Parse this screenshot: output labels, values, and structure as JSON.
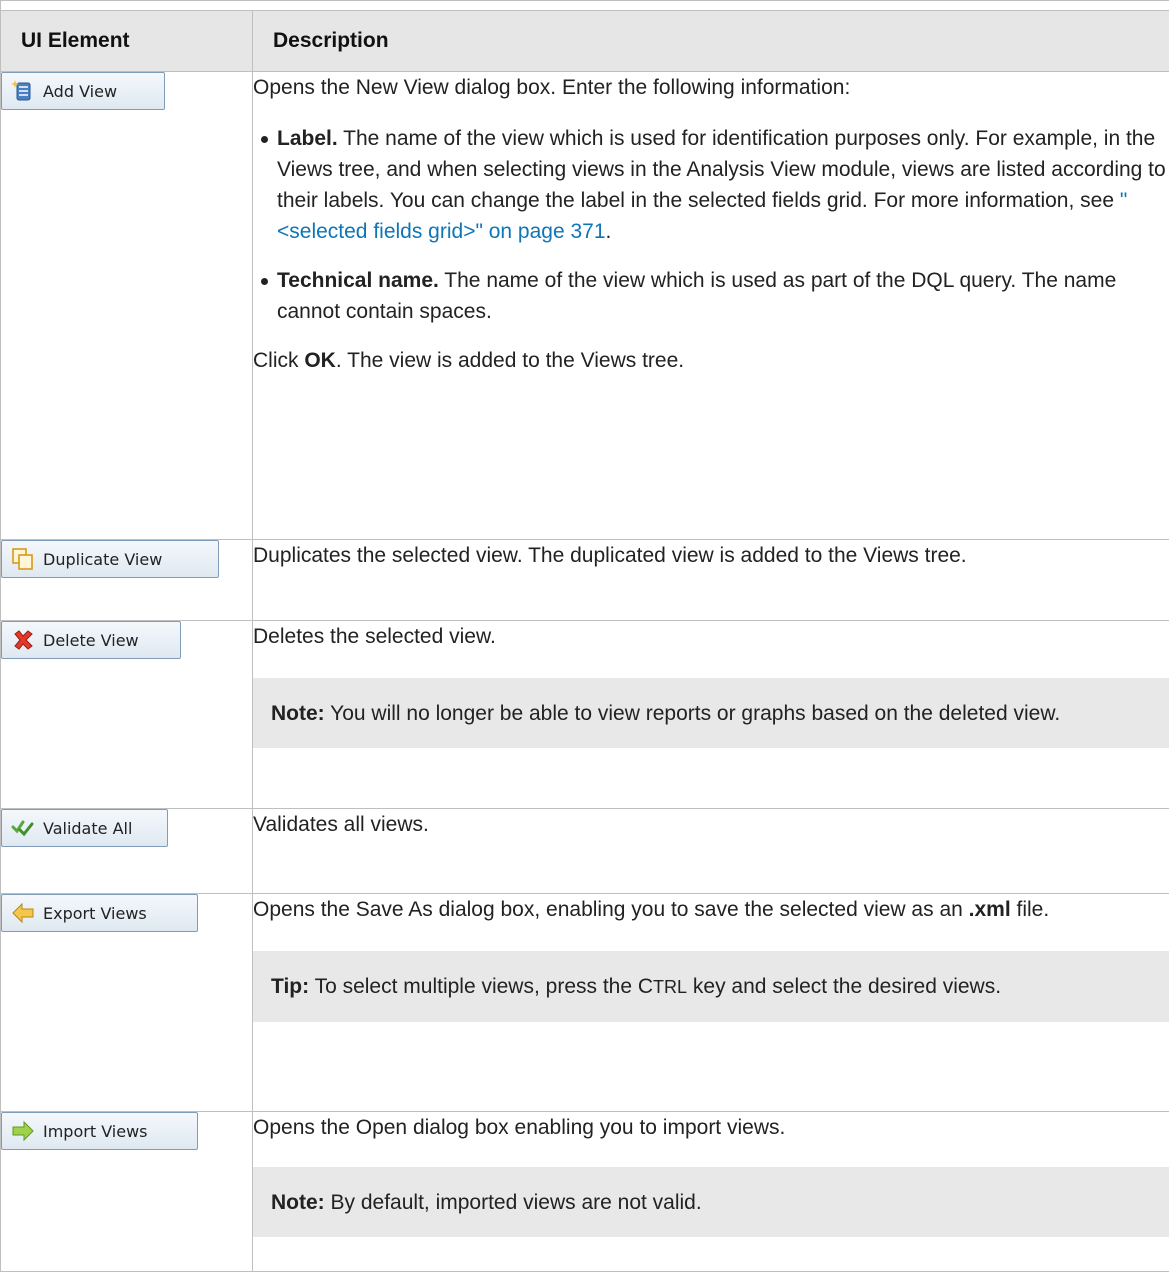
{
  "headers": {
    "ui_element": "UI Element",
    "description": "Description"
  },
  "rows": [
    {
      "button": {
        "label": "Add View",
        "icon": "add-view-icon"
      },
      "intro": "Opens the New View dialog box. Enter the following information:",
      "bullets": [
        {
          "term": "Label.",
          "text": " The name of the view which is used for identification purposes only. For example, in the Views tree, and when selecting views in the Analysis View module, views are listed according to their labels. You can change the label in the selected fields grid. For more information, see ",
          "link": "\"<selected fields grid>\" on page 371",
          "after": "."
        },
        {
          "term": "Technical name.",
          "text": " The name of the view which is used as part of the DQL query. The name cannot contain spaces."
        }
      ],
      "outro_pre": "Click ",
      "outro_bold": "OK",
      "outro_post": ". The view is added to the Views tree."
    },
    {
      "button": {
        "label": "Duplicate View",
        "icon": "duplicate-icon"
      },
      "text": "Duplicates the selected view. The duplicated view is added to the Views tree."
    },
    {
      "button": {
        "label": "Delete View",
        "icon": "delete-x-icon"
      },
      "text": "Deletes the selected view.",
      "note_label": "Note:",
      "note_text": " You will no longer be able to view reports or graphs based on the deleted view."
    },
    {
      "button": {
        "label": "Validate All",
        "icon": "validate-checkmarks-icon"
      },
      "text": "Validates all views."
    },
    {
      "button": {
        "label": "Export Views",
        "icon": "export-arrow-icon"
      },
      "text_pre": "Opens the Save As dialog box, enabling you to save the selected view as an ",
      "text_bold": ".xml",
      "text_post": " file.",
      "tip_label": "Tip:",
      "tip_pre": " To select multiple views, press the ",
      "tip_key_c": "C",
      "tip_key_rest": "TRL",
      "tip_post": " key and select the desired views."
    },
    {
      "button": {
        "label": "Import Views",
        "icon": "import-arrow-icon"
      },
      "text": "Opens the Open dialog box enabling you to import views.",
      "note_label": "Note:",
      "note_text": " By default, imported views are not valid."
    }
  ],
  "colors": {
    "header_bg": "#e6e6e6",
    "note_bg": "#e8e8e8",
    "link": "#0e75b7",
    "border": "#bfbfbf"
  }
}
